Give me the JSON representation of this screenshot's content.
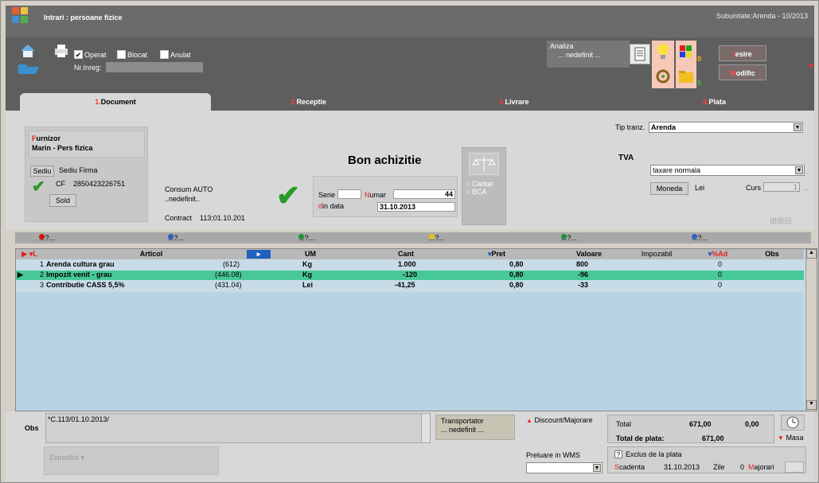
{
  "window": {
    "title": "Intrari : persoane fizice",
    "subunit": "Subunitate:Arenda - 10/2013"
  },
  "toolbar": {
    "operat": "Operat",
    "blocat": "Blocat",
    "anulat": "Anulat",
    "nr_inreg": "Nr.Inreg:",
    "analiza_label": "Analiza",
    "analiza_value": "... nedefinit ...",
    "counter_top": "0",
    "counter_bottom": "0",
    "iesire": "Iesire",
    "iesire_hotkey": "I",
    "modific": "Modific",
    "modific_hotkey": "M"
  },
  "tabs": [
    {
      "num": "1.",
      "label": "Document",
      "active": true
    },
    {
      "num": "2.",
      "label": "Receptie"
    },
    {
      "num": "3.",
      "label": "Livrare"
    },
    {
      "num": "4.",
      "label": "Plata"
    }
  ],
  "document": {
    "furnizor_label": "Furnizor",
    "furnizor_first": "F",
    "furnizor_rest": "urnizor",
    "furnizor_name": "Marin - Pers fizica",
    "sediu": "Sediu",
    "sediu_firma": "Sediu Firma",
    "cf_label": "CF",
    "cf_value": "2850423226751",
    "sold": "Sold",
    "consum_label": "Consum AUTO",
    "consum_value": "..nedefinit..",
    "contract_label": "Contract",
    "contract_value": "113;01.10.201",
    "bon_title": "Bon achizitie",
    "serie_label": "Serie",
    "numar_first": "N",
    "numar_rest": "umar",
    "numar_value": "44",
    "din_first": "d",
    "din_rest": "in data",
    "data_value": "31.10.2013",
    "cantar": "Cantar",
    "bca": "BCA",
    "tip_tranz_label": "Tip tranz.",
    "tip_tranz_value": "Arenda",
    "tva_label": "TVA",
    "tva_value": "taxare normala",
    "moneda": "Moneda",
    "moneda_value": "Lei",
    "curs_label": "Curs",
    "curs_value": "1",
    "ellipsis": "..."
  },
  "legend": [
    "...?...",
    "...?...",
    "...?...",
    "...?...",
    "...?...",
    "...?..."
  ],
  "legend_colors": [
    "#d01010",
    "#3060c0",
    "#209040",
    "#e8c020",
    "#209040",
    "#3060c0"
  ],
  "grid": {
    "columns": [
      "L",
      "Articol",
      "UM",
      "Cant",
      "Pret",
      "Valoare",
      "Impozabil",
      "%Ad",
      "Obs"
    ],
    "rows": [
      {
        "nr": "1",
        "articol": "Arenda cultura grau",
        "cod": "(612)",
        "um": "Kg",
        "cant": "1.000",
        "pret": "0,80",
        "valoare": "800",
        "ad": "0"
      },
      {
        "nr": "2",
        "articol": "Impozit venit - grau",
        "cod": "(446.08)",
        "um": "Kg",
        "cant": "-120",
        "pret": "0,80",
        "valoare": "-96",
        "ad": "0",
        "selected": true
      },
      {
        "nr": "3",
        "articol": "Contributie CASS 5,5%",
        "cod": "(431.04)",
        "um": "Lei",
        "cant": "-41,25",
        "pret": "0,80",
        "valoare": "-33",
        "ad": "0"
      }
    ]
  },
  "bottom": {
    "obs_label": "Obs",
    "obs_value": "*C.113/01.10.2013/",
    "transportator_label": "Transportator",
    "transportator_value": "... nedefinit ...",
    "discount": "Discount/Majorare",
    "total_label": "Total",
    "total_value": "671,00",
    "total_tva": "0,00",
    "total_plata_label": "Total de plata:",
    "total_plata_value": "671,00",
    "masa": "Masa",
    "expeditia": "Expeditia",
    "preluare_wms": "Preluare in WMS",
    "exclus_plata": "Exclus de la plata",
    "scadenta_first": "S",
    "scadenta_rest": "cadenta",
    "scadenta_value": "31.10.2013",
    "zile_label": "Zile",
    "zile_value": "0",
    "majorari_first": "M",
    "majorari_rest": "ajorari"
  }
}
